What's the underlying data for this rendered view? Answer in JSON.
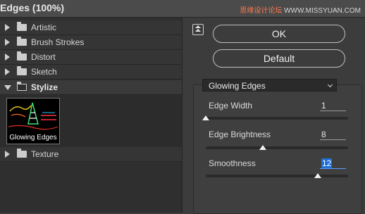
{
  "window": {
    "title": "Edges (100%)"
  },
  "watermark": {
    "brand_cn": "思缘设计论坛",
    "site": "WWW.MISSYUAN.COM"
  },
  "filter_tree": {
    "folders": [
      {
        "label": "Artistic",
        "expanded": false
      },
      {
        "label": "Brush Strokes",
        "expanded": false
      },
      {
        "label": "Distort",
        "expanded": false
      },
      {
        "label": "Sketch",
        "expanded": false
      },
      {
        "label": "Stylize",
        "expanded": true
      },
      {
        "label": "Texture",
        "expanded": false
      }
    ],
    "selected_thumbnail_label": "Glowing Edges"
  },
  "buttons": {
    "ok": "OK",
    "default": "Default"
  },
  "filter_select": {
    "value": "Glowing Edges"
  },
  "params": [
    {
      "label": "Edge Width",
      "value": "1",
      "min": 1,
      "max": 14,
      "current": 1
    },
    {
      "label": "Edge Brightness",
      "value": "8",
      "min": 0,
      "max": 20,
      "current": 8
    },
    {
      "label": "Smoothness",
      "value": "12",
      "min": 1,
      "max": 15,
      "current": 12
    }
  ],
  "colors": {
    "background": "#3c3c3c",
    "selection": "#1f6fd6",
    "brand_accent": "#ff7b4d"
  }
}
